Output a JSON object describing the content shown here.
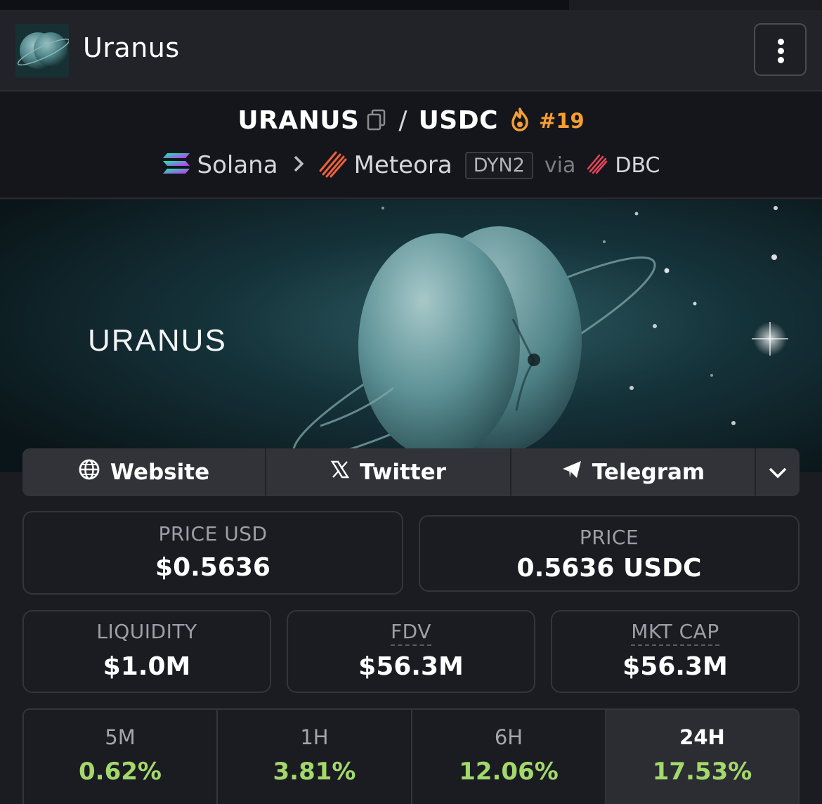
{
  "header": {
    "title": "Uranus"
  },
  "pair": {
    "base": "URANUS",
    "separator": "/",
    "quote": "USDC",
    "rank": "#19",
    "chain": "Solana",
    "dex": "Meteora",
    "dex_badge": "DYN2",
    "via": "via",
    "launchpad": "DBC"
  },
  "banner": {
    "title": "URANUS"
  },
  "links": {
    "website": "Website",
    "twitter": "Twitter",
    "telegram": "Telegram"
  },
  "stats": {
    "price_usd": {
      "label": "PRICE USD",
      "value": "$0.5636"
    },
    "price": {
      "label": "PRICE",
      "value": "0.5636 USDC"
    },
    "liquidity": {
      "label": "LIQUIDITY",
      "value": "$1.0M"
    },
    "fdv": {
      "label": "FDV",
      "value": "$56.3M"
    },
    "mkt_cap": {
      "label": "MKT CAP",
      "value": "$56.3M"
    }
  },
  "timeframes": [
    {
      "label": "5M",
      "change": "0.62%"
    },
    {
      "label": "1H",
      "change": "3.81%"
    },
    {
      "label": "6H",
      "change": "12.06%"
    },
    {
      "label": "24H",
      "change": "17.53%"
    }
  ],
  "colors": {
    "positive": "#a3d86b",
    "rank": "#f59e33",
    "accent_solana": "#9945ff"
  },
  "icons": {
    "menu": "more-vertical-icon",
    "copy": "copy-icon",
    "rank": "flame-icon",
    "website": "globe-icon",
    "twitter": "x-logo-icon",
    "telegram": "send-icon",
    "expand": "chevron-down-icon"
  }
}
